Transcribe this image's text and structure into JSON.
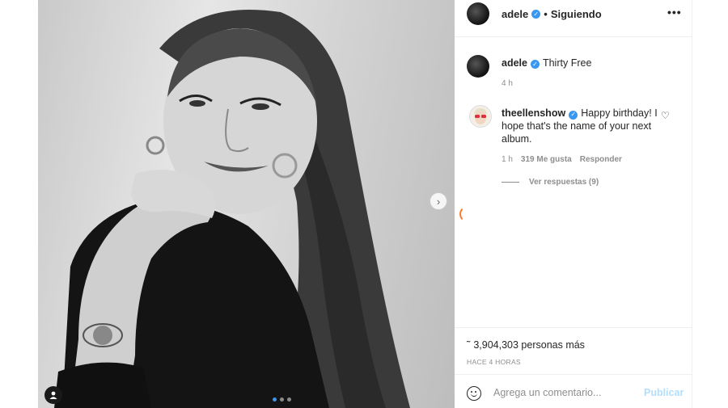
{
  "post": {
    "image_dots": 3,
    "active_dot": 0
  },
  "header": {
    "username": "adele",
    "separator": "•",
    "follow_status": "Siguiendo",
    "more_label": "•••"
  },
  "caption": {
    "username": "adele",
    "text": "Thirty Free",
    "time": "4 h"
  },
  "comment": {
    "username": "theellenshow",
    "text": "Happy birthday! I hope that's the name of your next album.",
    "time": "1 h",
    "likes": "319 Me gusta",
    "reply_label": "Responder",
    "view_replies": "Ver respuestas (9)"
  },
  "likes": {
    "text": "3,904,303 personas más"
  },
  "posted_time": "HACE 4 HORAS",
  "add_comment": {
    "placeholder": "Agrega un comentario...",
    "publish_label": "Publicar"
  },
  "colors": {
    "accent": "#3897f0",
    "publish_disabled": "#b2dffc",
    "muted_text": "#8e8e8e"
  }
}
